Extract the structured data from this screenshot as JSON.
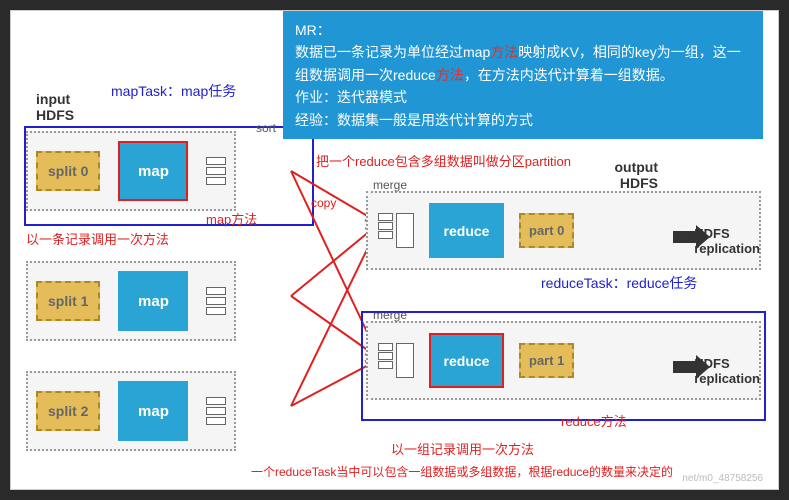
{
  "explain": {
    "title": "MR：",
    "line1a": "数据已一条记录为单位经过map",
    "line1b": "方法",
    "line1c": "映射成KV，相同的key为一组，这一组数据调用一次reduce",
    "line1d": "方法",
    "line1e": "，在方法内迭代计算着一组数据。",
    "line2": "作业：迭代器模式",
    "line3": "经验：数据集一般是用迭代计算的方式"
  },
  "labels": {
    "input_hdfs": "input\nHDFS",
    "maptask": "mapTask：map任务",
    "sort": "sort",
    "copy": "copy",
    "map_method": "map方法",
    "per_record": "以一条记录调用一次方法",
    "partition": "把一个reduce包含多组数据叫做分区partition",
    "output_hdfs": "output\nHDFS",
    "merge": "merge",
    "reducetask": "reduceTask：reduce任务",
    "reduce_method": "reduce方法",
    "per_group": "以一组记录调用一次方法",
    "multi_group": "一个reduceTask当中可以包含一组数据或多组数据，根据reduce的数量来决定的",
    "hdfs_rep": "HDFS\nreplication"
  },
  "splits": [
    "split 0",
    "split 1",
    "split 2"
  ],
  "map": "map",
  "reduce": "reduce",
  "parts": [
    "part 0",
    "part 1"
  ],
  "watermark": "net/m0_48758256"
}
